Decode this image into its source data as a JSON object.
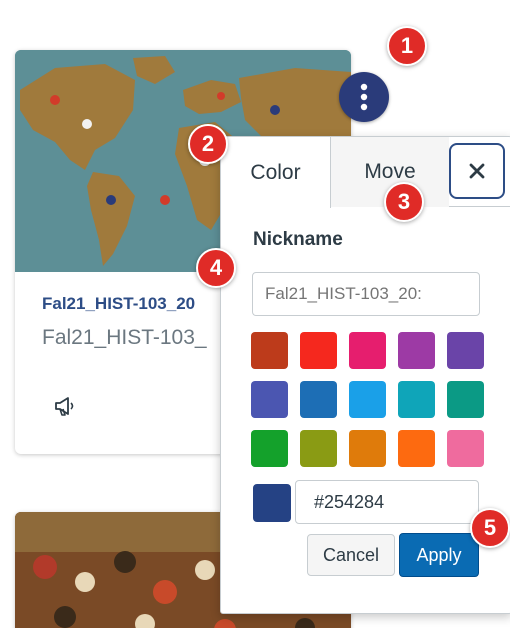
{
  "course_card": {
    "link_text": "Fal21_HIST-103_20",
    "subtitle": "Fal21_HIST-103_",
    "announcement_icon": "megaphone-icon",
    "hero_image": "world-map-illustration"
  },
  "second_card": {
    "hero_image": "crowd-painting"
  },
  "options_button_icon": "vertical-dots-icon",
  "popover": {
    "tabs": [
      {
        "label": "Color"
      },
      {
        "label": "Move"
      }
    ],
    "close_icon": "close-icon",
    "nickname_label": "Nickname",
    "nickname_placeholder": "Fal21_HIST-103_20:",
    "swatches": [
      "#bd3b1b",
      "#f5281e",
      "#e61e6e",
      "#9d3aa5",
      "#6a44a8",
      "#4b56b1",
      "#1d6eb5",
      "#1aa0e8",
      "#0fa5b9",
      "#0b9a85",
      "#14a12b",
      "#8a9b14",
      "#df7b0b",
      "#fd6a10",
      "#ef6b9e"
    ],
    "current_color": "#254284",
    "hex_value": "#254284",
    "cancel_label": "Cancel",
    "apply_label": "Apply"
  },
  "callouts": [
    "1",
    "2",
    "3",
    "4",
    "5"
  ],
  "colors": {
    "brand_dark": "#2a3b7a",
    "link": "#2d4d86",
    "apply": "#0a6bb3",
    "callout": "#e02b27"
  }
}
